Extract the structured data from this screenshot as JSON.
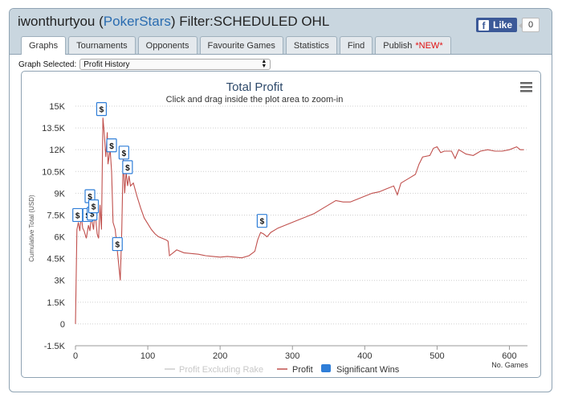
{
  "header": {
    "title_prefix": "iwonthurtyou (",
    "site": "PokerStars",
    "title_suffix": ") Filter:SCHEDULED OHL",
    "fb_like": "Like",
    "fb_count": "0"
  },
  "tabs": [
    {
      "label": "Graphs",
      "active": true
    },
    {
      "label": "Tournaments"
    },
    {
      "label": "Opponents"
    },
    {
      "label": "Favourite Games"
    },
    {
      "label": "Statistics"
    },
    {
      "label": "Find"
    },
    {
      "label": "Publish",
      "badge": "*NEW*"
    }
  ],
  "graph_select": {
    "label": "Graph Selected:",
    "value": "Profit History"
  },
  "chart_data": {
    "type": "line",
    "title": "Total Profit",
    "subtitle": "Click and drag inside the plot area to zoom-in",
    "ylabel": "Cumulative Total (USD)",
    "xlabel": "No. Games",
    "xlim": [
      0,
      625
    ],
    "ylim": [
      -1500,
      15000
    ],
    "x_ticks": [
      0,
      100,
      200,
      300,
      400,
      500,
      600
    ],
    "y_ticks": [
      -1500,
      0,
      1500,
      3000,
      4500,
      6000,
      7500,
      9000,
      10500,
      12000,
      13500,
      15000
    ],
    "y_tick_labels": [
      "-1.5K",
      "0",
      "1.5K",
      "3K",
      "4.5K",
      "6K",
      "7.5K",
      "9K",
      "10.5K",
      "12K",
      "13.5K",
      "15K"
    ],
    "legend": [
      "Profit Excluding Rake",
      "Profit",
      "Significant Wins"
    ],
    "legend_position": "bottom-center",
    "grid": "horizontal dotted",
    "colors": {
      "profit": "#c0504d",
      "excl_rake": "#cccccc",
      "wins": "#2f7ed8"
    },
    "series": [
      {
        "name": "Profit",
        "points": [
          [
            0,
            0
          ],
          [
            2,
            6500
          ],
          [
            4,
            7000
          ],
          [
            6,
            6400
          ],
          [
            8,
            7500
          ],
          [
            10,
            6600
          ],
          [
            12,
            6400
          ],
          [
            15,
            5900
          ],
          [
            18,
            6800
          ],
          [
            20,
            6400
          ],
          [
            22,
            7400
          ],
          [
            25,
            6500
          ],
          [
            27,
            7800
          ],
          [
            30,
            6200
          ],
          [
            32,
            5900
          ],
          [
            34,
            8200
          ],
          [
            36,
            6500
          ],
          [
            38,
            14200
          ],
          [
            40,
            13000
          ],
          [
            42,
            11500
          ],
          [
            44,
            13200
          ],
          [
            45,
            11000
          ],
          [
            48,
            12000
          ],
          [
            50,
            10500
          ],
          [
            52,
            7000
          ],
          [
            55,
            6500
          ],
          [
            58,
            5000
          ],
          [
            60,
            4000
          ],
          [
            62,
            3000
          ],
          [
            64,
            6500
          ],
          [
            66,
            11600
          ],
          [
            68,
            9000
          ],
          [
            70,
            10500
          ],
          [
            72,
            9500
          ],
          [
            74,
            10200
          ],
          [
            76,
            9500
          ],
          [
            80,
            9700
          ],
          [
            85,
            8800
          ],
          [
            90,
            8000
          ],
          [
            95,
            7300
          ],
          [
            100,
            6900
          ],
          [
            105,
            6500
          ],
          [
            110,
            6200
          ],
          [
            115,
            6000
          ],
          [
            120,
            5900
          ],
          [
            125,
            5800
          ],
          [
            128,
            5700
          ],
          [
            130,
            4700
          ],
          [
            135,
            4900
          ],
          [
            140,
            5100
          ],
          [
            150,
            4900
          ],
          [
            160,
            4850
          ],
          [
            170,
            4800
          ],
          [
            180,
            4700
          ],
          [
            190,
            4650
          ],
          [
            200,
            4600
          ],
          [
            210,
            4650
          ],
          [
            220,
            4600
          ],
          [
            230,
            4550
          ],
          [
            240,
            4700
          ],
          [
            248,
            5000
          ],
          [
            252,
            5800
          ],
          [
            256,
            6300
          ],
          [
            260,
            6200
          ],
          [
            265,
            6000
          ],
          [
            270,
            6300
          ],
          [
            280,
            6600
          ],
          [
            290,
            6800
          ],
          [
            300,
            7000
          ],
          [
            310,
            7200
          ],
          [
            320,
            7400
          ],
          [
            330,
            7600
          ],
          [
            340,
            7900
          ],
          [
            350,
            8200
          ],
          [
            360,
            8500
          ],
          [
            370,
            8400
          ],
          [
            380,
            8400
          ],
          [
            390,
            8600
          ],
          [
            400,
            8800
          ],
          [
            410,
            9000
          ],
          [
            420,
            9100
          ],
          [
            430,
            9300
          ],
          [
            440,
            9500
          ],
          [
            445,
            8900
          ],
          [
            450,
            9700
          ],
          [
            460,
            10000
          ],
          [
            470,
            10300
          ],
          [
            475,
            11000
          ],
          [
            480,
            11500
          ],
          [
            490,
            11600
          ],
          [
            495,
            12100
          ],
          [
            500,
            12200
          ],
          [
            505,
            11800
          ],
          [
            510,
            11900
          ],
          [
            520,
            11900
          ],
          [
            525,
            11400
          ],
          [
            530,
            12000
          ],
          [
            540,
            11700
          ],
          [
            550,
            11600
          ],
          [
            560,
            11900
          ],
          [
            570,
            12000
          ],
          [
            580,
            11900
          ],
          [
            590,
            11900
          ],
          [
            600,
            12000
          ],
          [
            610,
            12200
          ],
          [
            615,
            12000
          ],
          [
            620,
            12000
          ]
        ]
      }
    ],
    "significant_wins": [
      [
        3,
        7500
      ],
      [
        17,
        7500
      ],
      [
        20,
        8800
      ],
      [
        23,
        7600
      ],
      [
        25,
        8100
      ],
      [
        36,
        14800
      ],
      [
        50,
        12300
      ],
      [
        58,
        5500
      ],
      [
        67,
        11800
      ],
      [
        72,
        10800
      ],
      [
        258,
        7100
      ]
    ],
    "marker_label": "$"
  }
}
